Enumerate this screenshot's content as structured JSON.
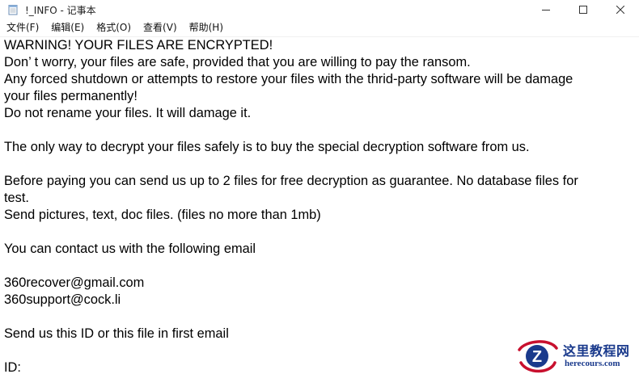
{
  "window": {
    "title": "!_INFO - 记事本",
    "icon": "notepad-icon",
    "controls": [
      "minimize-icon",
      "maximize-icon",
      "close-icon"
    ]
  },
  "menu": [
    {
      "label": "文件(F)"
    },
    {
      "label": "编辑(E)"
    },
    {
      "label": "格式(O)"
    },
    {
      "label": "查看(V)"
    },
    {
      "label": "帮助(H)"
    }
  ],
  "document": {
    "lines": [
      "WARNING! YOUR FILES ARE ENCRYPTED!",
      "Don’ t worry, your files are safe, provided that you are willing to pay the ransom.",
      "Any forced shutdown or attempts to restore your files with the thrid-party software will be damage",
      "your files permanently!",
      "Do not rename your files. It will damage it.",
      "",
      "The only way to decrypt your files safely is to buy the special decryption software from us.",
      "",
      "Before paying you can send us up to 2 files for free decryption as guarantee. No database files for",
      "test.",
      "Send pictures, text, doc files. (files no more than 1mb)",
      "",
      "You can contact us with the following email",
      "",
      "360recover@gmail.com",
      "360support@cock.li",
      "",
      "Send us this ID or this file in first email",
      "",
      "ID:"
    ]
  },
  "watermark": {
    "logo_letter": "Z",
    "name": "这里教程网",
    "domain": "herecours.com",
    "colors": {
      "blue": "#1a3a8c",
      "red": "#c8102e"
    }
  }
}
